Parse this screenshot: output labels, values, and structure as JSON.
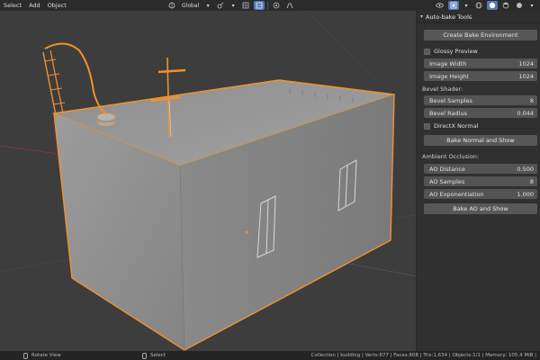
{
  "header": {
    "menus": [
      "Select",
      "Add",
      "Object"
    ],
    "orientation": "Global",
    "icons": [
      "transform-pivot-icon",
      "snap-icon",
      "snap-increment-icon",
      "proportional-editing-icon",
      "visibility-icon",
      "xray-icon",
      "shading-wire-icon",
      "shading-solid-icon",
      "shading-material-icon",
      "shading-rendered-icon"
    ]
  },
  "panel": {
    "title": "Auto-bake Tools",
    "create_env_label": "Create Bake Environment",
    "glossy_preview_label": "Glossy Preview",
    "image_width": {
      "label": "Image Width",
      "value": "1024"
    },
    "image_height": {
      "label": "Image Height",
      "value": "1024"
    },
    "bevel_section": "Bevel Shader:",
    "bevel_samples": {
      "label": "Bevel Samples",
      "value": "8"
    },
    "bevel_radius": {
      "label": "Bevel Radius",
      "value": "0.044"
    },
    "directx_label": "DirectX Normal",
    "bake_normal_label": "Bake Normal and Show",
    "ao_section": "Ambient Occlusion:",
    "ao_distance": {
      "label": "AO Distance",
      "value": "0.500"
    },
    "ao_samples": {
      "label": "AO Samples",
      "value": "8"
    },
    "ao_exponentiation": {
      "label": "AO Exponentiation",
      "value": "1.000"
    },
    "bake_ao_label": "Bake AO and Show"
  },
  "statusbar": {
    "rotate_view": "Rotate View",
    "select": "Select",
    "stats": "Collection | building | Verts:877 | Faces:808 | Tris:1,634 | Objects:1/1 | Memory: 105.4 MiB |"
  },
  "colors": {
    "accent": "#5378b5",
    "selection_outline": "#f0922c",
    "viewport_bg": "#3d3d3d",
    "panel_bg": "#303030"
  }
}
